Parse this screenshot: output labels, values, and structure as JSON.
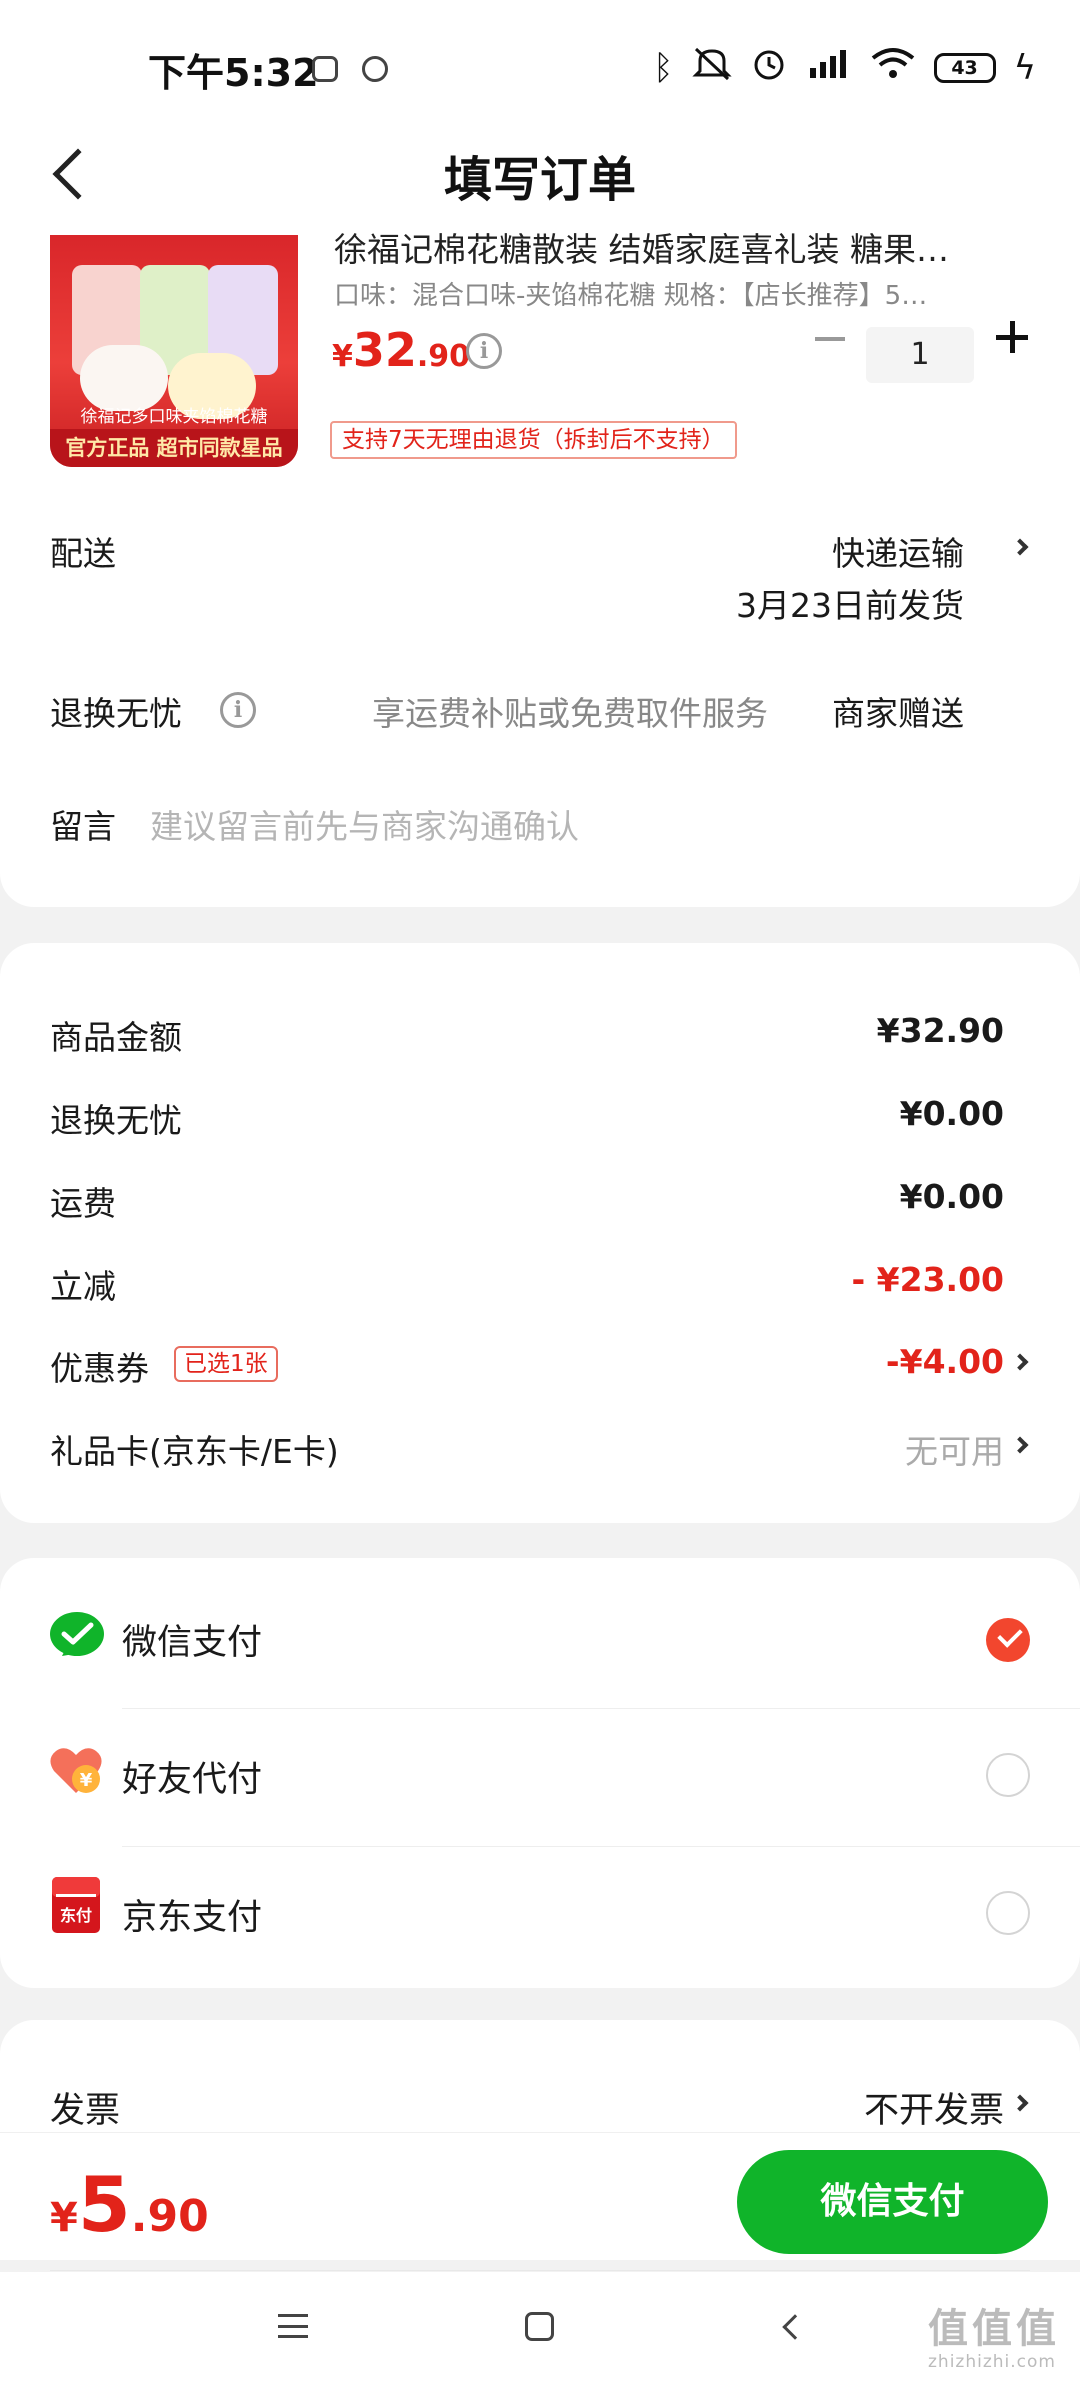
{
  "status_bar": {
    "time": "下午5:32",
    "battery": "43",
    "icons": [
      "wechat-icon",
      "app-icon",
      "bluetooth-icon",
      "mute-icon",
      "alarm-icon",
      "signal-icon",
      "wifi-icon",
      "battery-icon",
      "charging-icon"
    ]
  },
  "header": {
    "title": "填写订单"
  },
  "product": {
    "title": "徐福记棉花糖散装 结婚家庭喜礼装 糖果…",
    "spec": "口味：混合口味-夹馅棉花糖   规格：【店长推荐】5…",
    "price_yen": "¥",
    "price_int": "32",
    "price_dec": ".90",
    "quantity": "1",
    "return_tag": "支持7天无理由退货（拆封后不支持）",
    "image_caption": "徐福记多口味夹馅棉花糖",
    "image_band": "官方正品 超市同款星品"
  },
  "delivery": {
    "label": "配送",
    "method": "快递运输",
    "date": "3月23日前发货"
  },
  "worry_free": {
    "label": "退换无忧",
    "desc": "享运费补贴或免费取件服务",
    "value": "商家赠送"
  },
  "message": {
    "label": "留言",
    "placeholder": "建议留言前先与商家沟通确认"
  },
  "summary": {
    "rows": [
      {
        "label": "商品金额",
        "value": "¥32.90"
      },
      {
        "label": "退换无忧",
        "value": "¥0.00"
      },
      {
        "label": "运费",
        "value": "¥0.00"
      },
      {
        "label": "立减",
        "value": "- ¥23.00"
      },
      {
        "label": "优惠券",
        "value": "-¥4.00"
      },
      {
        "label": "礼品卡(京东卡/E卡)",
        "value": "无可用"
      }
    ],
    "coupon_tag": "已选1张"
  },
  "payment": {
    "methods": [
      {
        "label": "微信支付",
        "selected": true
      },
      {
        "label": "好友代付",
        "selected": false
      },
      {
        "label": "京东支付",
        "selected": false
      }
    ],
    "friend_icon_text": "¥",
    "jd_icon_text": "东付"
  },
  "invoice": {
    "label": "发票",
    "value": "不开发票"
  },
  "bottom_bar": {
    "total_yen": "¥",
    "total_int": "5",
    "total_dec": ".90",
    "pay_button": "微信支付"
  },
  "watermark": {
    "big": "值值值",
    "small": "zhizhizhi.com"
  },
  "colors": {
    "price_red": "#e2231a",
    "wechat_green": "#10b42a",
    "radio_selected": "#f2462e"
  }
}
